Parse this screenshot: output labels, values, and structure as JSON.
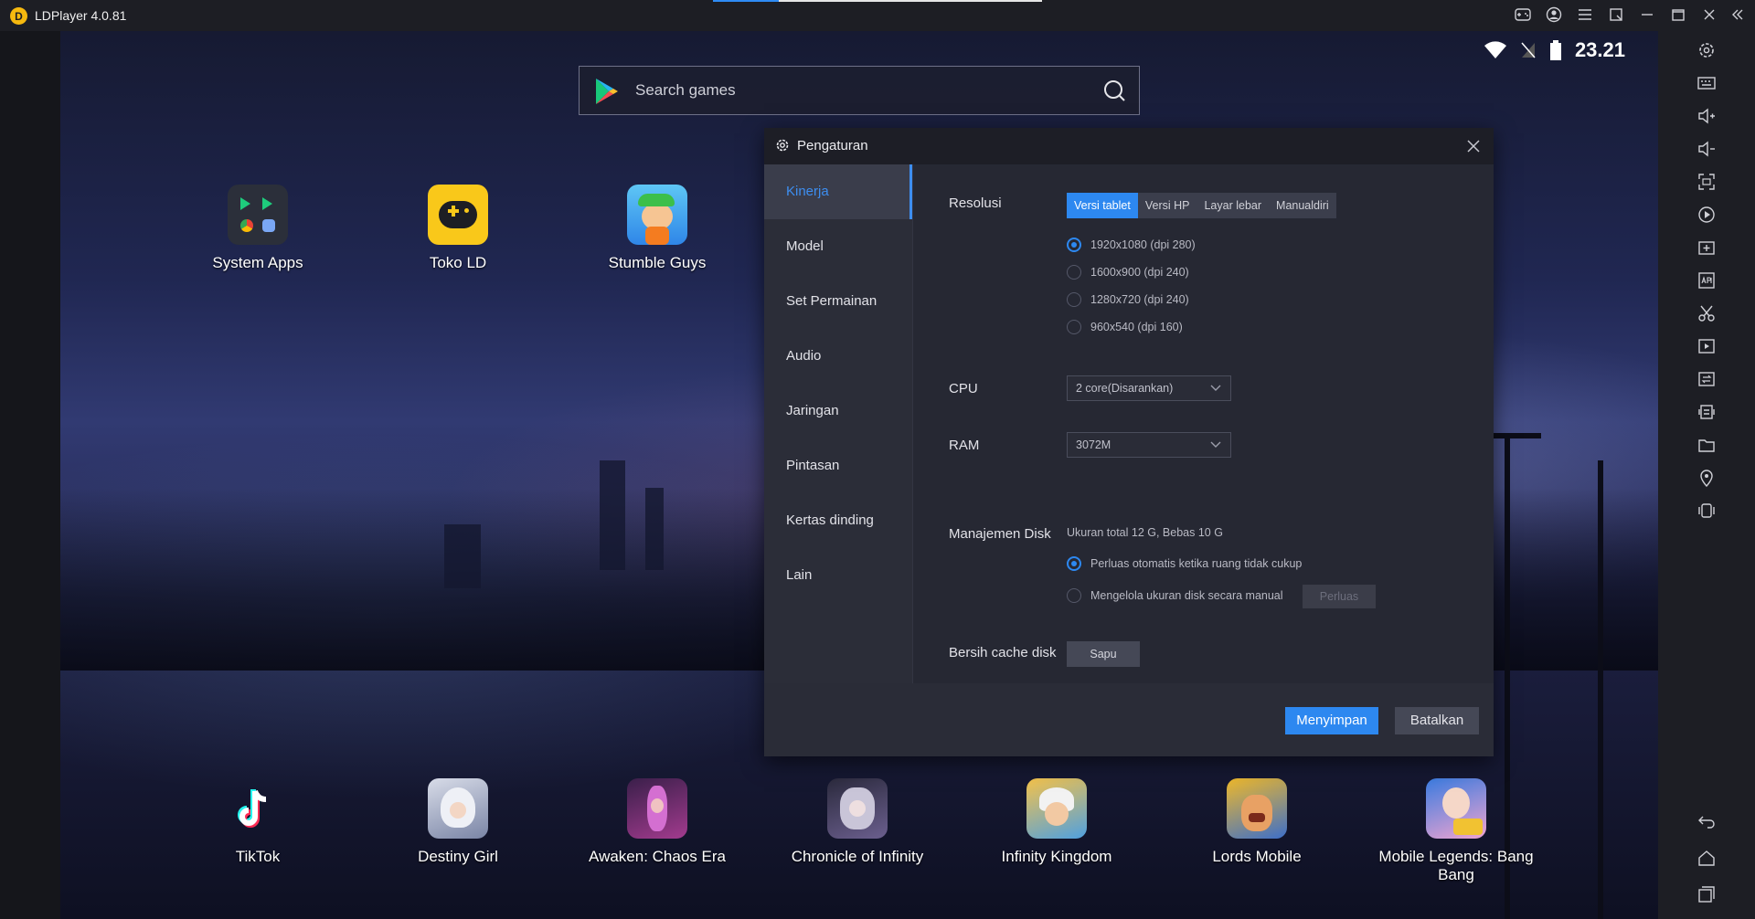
{
  "titlebar": {
    "app_title": "LDPlayer 4.0.81",
    "progress_fraction": 0.2
  },
  "status": {
    "time": "23.21"
  },
  "search": {
    "placeholder": "Search games"
  },
  "apps_top": [
    {
      "name": "System Apps",
      "icon": "system-apps-icon"
    },
    {
      "name": "Toko LD",
      "icon": "toko-ld-icon"
    },
    {
      "name": "Stumble Guys",
      "icon": "stumble-guys-icon"
    }
  ],
  "apps_bottom": [
    {
      "name": "TikTok",
      "icon": "tiktok-icon"
    },
    {
      "name": "Destiny Girl",
      "icon": "destiny-girl-icon"
    },
    {
      "name": "Awaken: Chaos Era",
      "icon": "awaken-chaos-era-icon"
    },
    {
      "name": "Chronicle of Infinity",
      "icon": "chronicle-of-infinity-icon"
    },
    {
      "name": "Infinity Kingdom",
      "icon": "infinity-kingdom-icon"
    },
    {
      "name": "Lords Mobile",
      "icon": "lords-mobile-icon"
    },
    {
      "name": "Mobile Legends: Bang Bang",
      "icon": "mobile-legends-icon"
    }
  ],
  "dialog": {
    "title": "Pengaturan",
    "nav": [
      "Kinerja",
      "Model",
      "Set Permainan",
      "Audio",
      "Jaringan",
      "Pintasan",
      "Kertas dinding",
      "Lain"
    ],
    "active_nav": "Kinerja",
    "resolution": {
      "label": "Resolusi",
      "tabs": [
        "Versi tablet",
        "Versi HP",
        "Layar lebar",
        "Manualdiri"
      ],
      "active_tab": "Versi tablet",
      "options": [
        "1920x1080  (dpi 280)",
        "1600x900  (dpi 240)",
        "1280x720  (dpi 240)",
        "960x540  (dpi 160)"
      ],
      "selected": "1920x1080  (dpi 280)"
    },
    "cpu": {
      "label": "CPU",
      "value": "2 core(Disarankan)"
    },
    "ram": {
      "label": "RAM",
      "value": "3072M"
    },
    "disk": {
      "label": "Manajemen Disk",
      "info": "Ukuran total 12 G,  Bebas 10 G",
      "option_auto": "Perluas otomatis ketika ruang tidak cukup",
      "option_manual": "Mengelola ukuran disk secara manual",
      "expand_button": "Perluas"
    },
    "cache": {
      "label": "Bersih cache disk",
      "button": "Sapu"
    },
    "footer": {
      "save": "Menyimpan",
      "cancel": "Batalkan"
    }
  },
  "colors": {
    "accent": "#2d88f0",
    "titlebar": "#1d1e24",
    "dialog_bg": "#262833"
  }
}
